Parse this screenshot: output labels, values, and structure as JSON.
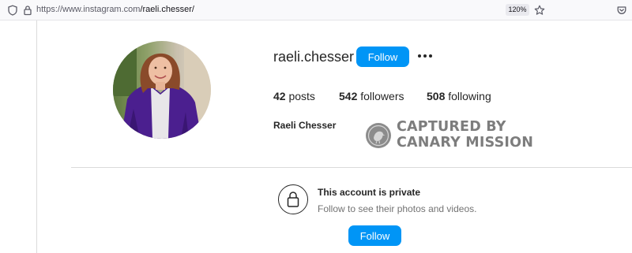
{
  "browser": {
    "url_prefix": "https://www.instagram.com",
    "url_path": "/raeli.chesser/",
    "zoom": "120%"
  },
  "profile": {
    "username": "raeli.chesser",
    "follow_label": "Follow",
    "more_icon": "more-horizontal-icon",
    "posts_count": "42",
    "posts_label": "posts",
    "followers_count": "542",
    "followers_label": "followers",
    "following_count": "508",
    "following_label": "following",
    "full_name": "Raeli Chesser"
  },
  "watermark": {
    "line1": "CAPTURED BY",
    "line2": "CANARY MISSION"
  },
  "private_notice": {
    "title": "This account is private",
    "subtitle": "Follow to see their photos and videos.",
    "follow_label": "Follow",
    "icon": "lock-icon"
  },
  "colors": {
    "accent": "#0095f6",
    "text": "#262626",
    "secondary_text": "#737373",
    "watermark": "#7d7d7d"
  }
}
